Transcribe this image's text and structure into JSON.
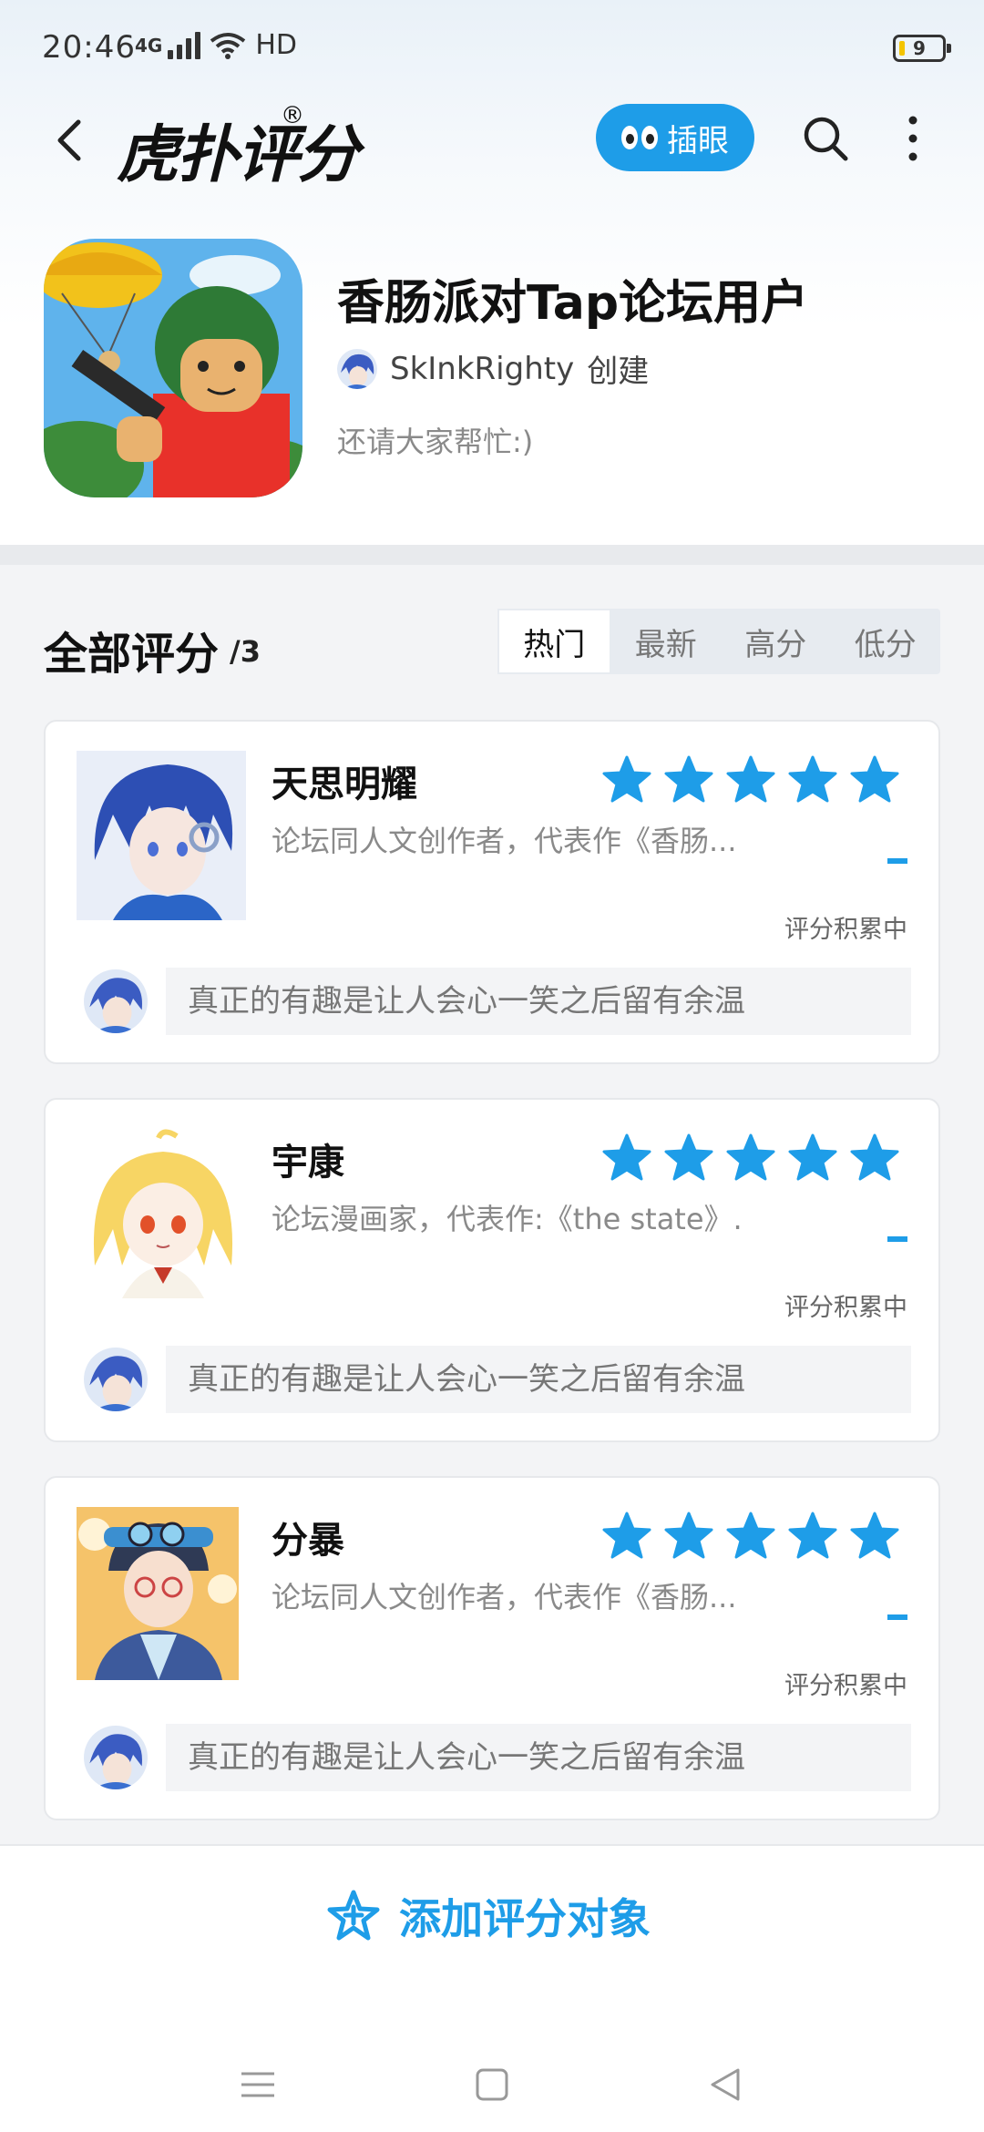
{
  "status_bar": {
    "time": "20:46",
    "network": "4G",
    "hd": "HD",
    "battery": "9"
  },
  "nav": {
    "logo_text": "虎扑评分",
    "logo_reg": "®",
    "peek_label": "插眼"
  },
  "post": {
    "title": "香肠派对Tap论坛用户",
    "creator_name": "SkInkRighty",
    "creator_suffix": "创建",
    "description": "还请大家帮忙:)"
  },
  "ratings": {
    "title": "全部评分",
    "count": "/3",
    "tabs": [
      {
        "label": "热门",
        "active": true
      },
      {
        "label": "最新",
        "active": false
      },
      {
        "label": "高分",
        "active": false
      },
      {
        "label": "低分",
        "active": false
      }
    ],
    "items": [
      {
        "name": "天思明耀",
        "subtitle": "论坛同人文创作者，代表作《香肠...",
        "status": "评分积累中",
        "comment": "真正的有趣是让人会心一笑之后留有余温",
        "avatar": "blue-hair-anime-boy"
      },
      {
        "name": "宇康",
        "subtitle": "论坛漫画家，代表作:《the state》...",
        "status": "评分积累中",
        "comment": "真正的有趣是让人会心一笑之后留有余温",
        "avatar": "blonde-anime-girl"
      },
      {
        "name": "分暴",
        "subtitle": "论坛同人文创作者，代表作《香肠...",
        "status": "评分积累中",
        "comment": "真正的有趣是让人会心一笑之后留有余温",
        "avatar": "goggles-anime-boy"
      }
    ]
  },
  "footer": {
    "add_label": "添加评分对象"
  },
  "colors": {
    "accent": "#1e9de8",
    "star": "#1e9de8"
  }
}
